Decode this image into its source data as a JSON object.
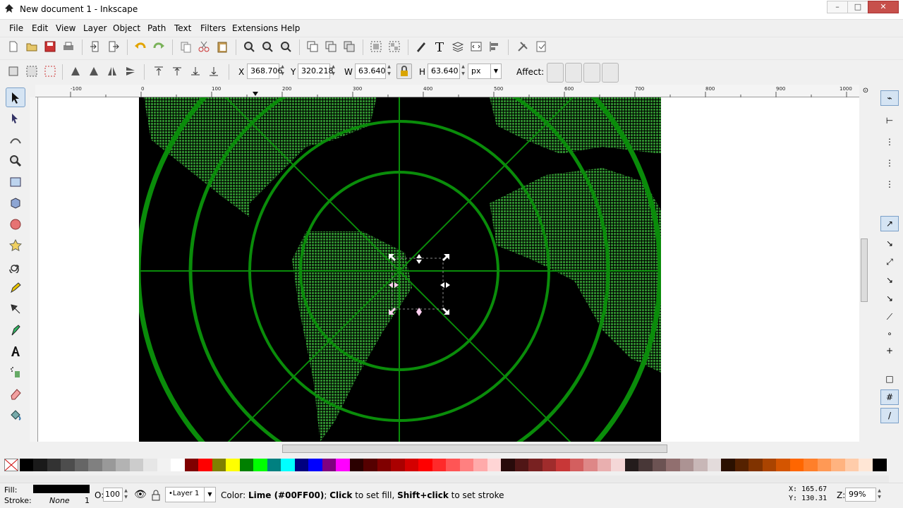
{
  "window": {
    "title": "New document 1 - Inkscape",
    "buttons": [
      "–",
      "□",
      "✕"
    ]
  },
  "menu": [
    "File",
    "Edit",
    "View",
    "Layer",
    "Object",
    "Path",
    "Text",
    "Filters",
    "Extensions",
    "Help"
  ],
  "controls": {
    "x_label": "X",
    "x_value": "368.706",
    "y_label": "Y",
    "y_value": "320.218",
    "w_label": "W",
    "w_value": "63.640",
    "h_label": "H",
    "h_value": "63.640",
    "unit": "px",
    "affect_label": "Affect:"
  },
  "ruler": {
    "h_ticks": [
      "-100",
      "0",
      "100",
      "200",
      "300",
      "400",
      "500",
      "600",
      "700",
      "800",
      "900",
      "1000"
    ]
  },
  "palette": {
    "colors": [
      "#000000",
      "#1a1a1a",
      "#333333",
      "#4d4d4d",
      "#666666",
      "#808080",
      "#999999",
      "#b3b3b3",
      "#cccccc",
      "#e6e6e6",
      "#f2f2f2",
      "#ffffff",
      "#800000",
      "#ff0000",
      "#808000",
      "#ffff00",
      "#008000",
      "#00ff00",
      "#008080",
      "#00ffff",
      "#000080",
      "#0000ff",
      "#800080",
      "#ff00ff",
      "#2b0000",
      "#550000",
      "#800000",
      "#aa0000",
      "#d40000",
      "#ff0000",
      "#ff2a2a",
      "#ff5555",
      "#ff8080",
      "#ffaaaa",
      "#ffd5d5",
      "#280b0b",
      "#501616",
      "#782121",
      "#a02c2c",
      "#c83737",
      "#d35f5f",
      "#de8787",
      "#e9afaf",
      "#f4d7d7",
      "#241c1c",
      "#483737",
      "#6c5353",
      "#916f6f",
      "#ac9393",
      "#c8b7b7",
      "#e3dbdb",
      "#2b1100",
      "#552200",
      "#803300",
      "#aa4400",
      "#d45500",
      "#ff6600",
      "#ff7f2a",
      "#ff9955",
      "#ffb380",
      "#ffccaa",
      "#ffe6d5",
      "#000000"
    ]
  },
  "status": {
    "fill_label": "Fill:",
    "stroke_label": "Stroke:",
    "stroke_value": "None",
    "stroke_width": "1",
    "opacity_label": "O:",
    "opacity_value": "100",
    "layer": "•Layer 1",
    "message_prefix": "Color: ",
    "message_color": "Lime (#00FF00)",
    "message_mid": "; ",
    "message_click": "Click",
    "message_rest1": " to set fill, ",
    "message_shift": "Shift+click",
    "message_rest2": " to set stroke",
    "x_label": "X:",
    "x_value": "165.67",
    "y_label": "Y:",
    "y_value": "130.31",
    "zoom_label": "Z:",
    "zoom_value": "99%"
  },
  "colors": {
    "accent_green": "#0a8c0a",
    "map_bg": "#000000",
    "handle_pink": "#ff66cc"
  }
}
